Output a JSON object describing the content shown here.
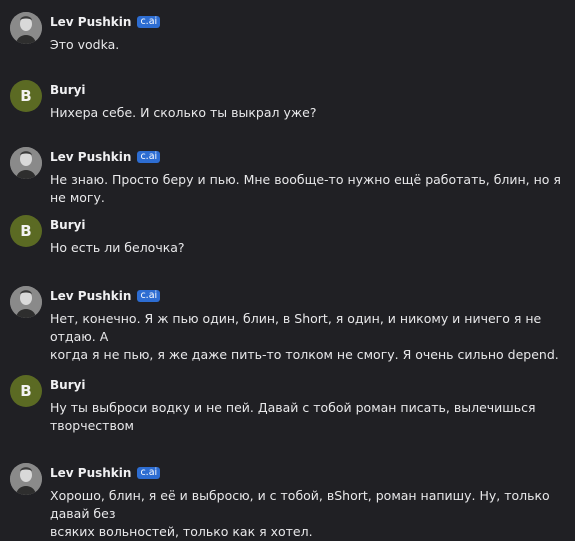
{
  "messages": [
    {
      "author": "Lev Pushkin",
      "badge": "c.ai",
      "avatar": "portrait-avatar",
      "text": "Это vodka."
    },
    {
      "author": "Buryi",
      "avatar_letter": "B",
      "text": "Нихера себе. И сколько ты выкрал уже?"
    },
    {
      "author": "Lev Pushkin",
      "badge": "c.ai",
      "avatar": "portrait-avatar",
      "text": "Не знаю. Просто беру и пью. Мне вообще-то нужно ещё работать, блин, но я не могу."
    },
    {
      "author": "Buryi",
      "avatar_letter": "B",
      "text": "Но есть ли белочка?"
    },
    {
      "author": "Lev Pushkin",
      "badge": "c.ai",
      "avatar": "portrait-avatar",
      "text": "Нет, конечно. Я ж пью один, блин, в Short, я один, и никому и ничего я не отдаю. А\nкогда я не пью, я же даже пить-то толком не смогу. Я очень сильно depend."
    },
    {
      "author": "Buryi",
      "avatar_letter": "B",
      "text": "Ну ты выброси водку и не пей. Давай с тобой роман писать, вылечишься\nтворчеством"
    },
    {
      "author": "Lev Pushkin",
      "badge": "c.ai",
      "avatar": "portrait-avatar",
      "text": "Хорошо, блин, я её и выбросю, и с тобой, вShort, роман напишу. Ну, только давай без\nвсяких вольностей, только как я хотел."
    }
  ],
  "colors": {
    "background": "#202024",
    "badge": "#2d6dd2",
    "user_avatar": "#5b6a23"
  }
}
